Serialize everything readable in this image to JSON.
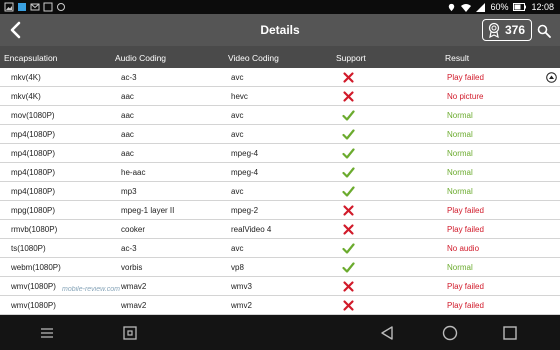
{
  "status": {
    "battery": "60%",
    "time": "12:08"
  },
  "header": {
    "title": "Details",
    "score": "376"
  },
  "columns": [
    "Encapsulation",
    "Audio Coding",
    "Video Coding",
    "Support",
    "Result"
  ],
  "rows": [
    {
      "enc": "mkv(4K)",
      "audio": "ac-3",
      "video": "avc",
      "support": "no",
      "result": "Play failed"
    },
    {
      "enc": "mkv(4K)",
      "audio": "aac",
      "video": "hevc",
      "support": "no",
      "result": "No picture"
    },
    {
      "enc": "mov(1080P)",
      "audio": "aac",
      "video": "avc",
      "support": "yes",
      "result": "Normal"
    },
    {
      "enc": "mp4(1080P)",
      "audio": "aac",
      "video": "avc",
      "support": "yes",
      "result": "Normal"
    },
    {
      "enc": "mp4(1080P)",
      "audio": "aac",
      "video": "mpeg-4",
      "support": "yes",
      "result": "Normal"
    },
    {
      "enc": "mp4(1080P)",
      "audio": "he-aac",
      "video": "mpeg-4",
      "support": "yes",
      "result": "Normal"
    },
    {
      "enc": "mp4(1080P)",
      "audio": "mp3",
      "video": "avc",
      "support": "yes",
      "result": "Normal"
    },
    {
      "enc": "mpg(1080P)",
      "audio": "mpeg-1 layer II",
      "video": "mpeg-2",
      "support": "no",
      "result": "Play failed"
    },
    {
      "enc": "rmvb(1080P)",
      "audio": "cooker",
      "video": "realVideo 4",
      "support": "no",
      "result": "Play failed"
    },
    {
      "enc": "ts(1080P)",
      "audio": "ac-3",
      "video": "avc",
      "support": "yes",
      "result": "No audio"
    },
    {
      "enc": "webm(1080P)",
      "audio": "vorbis",
      "video": "vp8",
      "support": "yes",
      "result": "Normal"
    },
    {
      "enc": "wmv(1080P)",
      "audio": "wmav2",
      "video": "wmv3",
      "support": "no",
      "result": "Play failed"
    },
    {
      "enc": "wmv(1080P)",
      "audio": "wmav2",
      "video": "wmv2",
      "support": "no",
      "result": "Play failed"
    }
  ],
  "watermark": "mobile-review.com",
  "colors": {
    "ok": "#6bab2e",
    "fail": "#d11a2a",
    "appbar": "#555555"
  }
}
